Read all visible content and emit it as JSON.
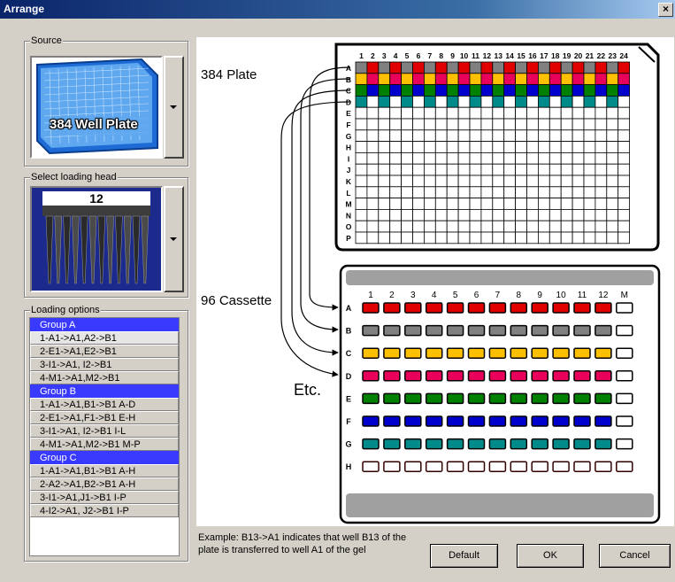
{
  "window": {
    "title": "Arrange",
    "close_glyph": "×"
  },
  "source": {
    "label": "Source",
    "thumbnail_text": "384 Well Plate"
  },
  "loading_head": {
    "label": "Select loading head",
    "tips": "12"
  },
  "loading_options": {
    "label": "Loading options",
    "items": [
      {
        "text": "Group A",
        "kind": "group"
      },
      {
        "text": "1-A1->A1,A2->B1",
        "kind": "option",
        "selected": true
      },
      {
        "text": "2-E1->A1,E2->B1",
        "kind": "option"
      },
      {
        "text": "3-I1->A1, I2->B1",
        "kind": "option"
      },
      {
        "text": "4-M1->A1,M2->B1",
        "kind": "option"
      },
      {
        "text": "Group B",
        "kind": "group"
      },
      {
        "text": "1-A1->A1,B1->B1  A-D",
        "kind": "option"
      },
      {
        "text": "2-E1->A1,F1->B1  E-H",
        "kind": "option"
      },
      {
        "text": "3-I1->A1, I2->B1  I-L",
        "kind": "option"
      },
      {
        "text": "4-M1->A1,M2->B1  M-P",
        "kind": "option"
      },
      {
        "text": "Group C",
        "kind": "group"
      },
      {
        "text": "1-A1->A1,B1->B1  A-H",
        "kind": "option"
      },
      {
        "text": "2-A2->A1,B2->B1  A-H",
        "kind": "option"
      },
      {
        "text": "3-I1->A1,J1->B1  I-P",
        "kind": "option"
      },
      {
        "text": "4-I2->A1, J2->B1 I-P",
        "kind": "option"
      }
    ]
  },
  "diagram": {
    "plate_label": "384 Plate",
    "cassette_label": "96 Cassette",
    "etc_label": "Etc.",
    "plate_cols": [
      "1",
      "2",
      "3",
      "4",
      "5",
      "6",
      "7",
      "8",
      "9",
      "10",
      "11",
      "12",
      "13",
      "14",
      "15",
      "16",
      "17",
      "18",
      "19",
      "20",
      "21",
      "22",
      "23",
      "24"
    ],
    "plate_rows": [
      "A",
      "B",
      "C",
      "D",
      "E",
      "F",
      "G",
      "H",
      "I",
      "J",
      "K",
      "L",
      "M",
      "N",
      "O",
      "P"
    ],
    "cassette_cols": [
      "1",
      "2",
      "3",
      "4",
      "5",
      "6",
      "7",
      "8",
      "9",
      "10",
      "11",
      "12",
      "M"
    ],
    "cassette_rows": [
      "A",
      "B",
      "C",
      "D",
      "E",
      "F",
      "G",
      "H"
    ],
    "colors": {
      "grey": "#808080",
      "yellow": "#ffc000",
      "red": "#e00000",
      "green": "#008000",
      "blue": "#0000cc",
      "teal": "#008b8b",
      "pink": "#e8005a",
      "dark": "#330000"
    },
    "plate_row_colors": {
      "A": [
        "grey",
        "red",
        "grey",
        "red",
        "grey",
        "red",
        "grey",
        "red",
        "grey",
        "red",
        "grey",
        "red",
        "grey",
        "red",
        "grey",
        "red",
        "grey",
        "red",
        "grey",
        "red",
        "grey",
        "red",
        "grey",
        "red"
      ],
      "B": [
        "yellow",
        "pink",
        "yellow",
        "pink",
        "yellow",
        "pink",
        "yellow",
        "pink",
        "yellow",
        "pink",
        "yellow",
        "pink",
        "yellow",
        "pink",
        "yellow",
        "pink",
        "yellow",
        "pink",
        "yellow",
        "pink",
        "yellow",
        "pink",
        "yellow",
        "pink"
      ],
      "C": [
        "green",
        "blue",
        "green",
        "blue",
        "green",
        "blue",
        "green",
        "blue",
        "green",
        "blue",
        "green",
        "blue",
        "green",
        "blue",
        "green",
        "blue",
        "green",
        "blue",
        "green",
        "blue",
        "green",
        "blue",
        "green",
        "blue"
      ],
      "D": [
        "teal",
        "",
        "teal",
        "",
        "teal",
        "",
        "teal",
        "",
        "teal",
        "",
        "teal",
        "",
        "teal",
        "",
        "teal",
        "",
        "teal",
        "",
        "teal",
        "",
        "teal",
        "",
        "teal",
        ""
      ]
    },
    "cassette_row_colors": {
      "A": "red",
      "B": "grey",
      "C": "yellow",
      "D": "pink",
      "E": "green",
      "F": "blue",
      "G": "teal",
      "H": "dark"
    }
  },
  "example_text": "Example: B13->A1 indicates that well B13 of the plate is transferred to well A1 of the gel",
  "buttons": {
    "default": "Default",
    "ok": "OK",
    "cancel": "Cancel"
  }
}
